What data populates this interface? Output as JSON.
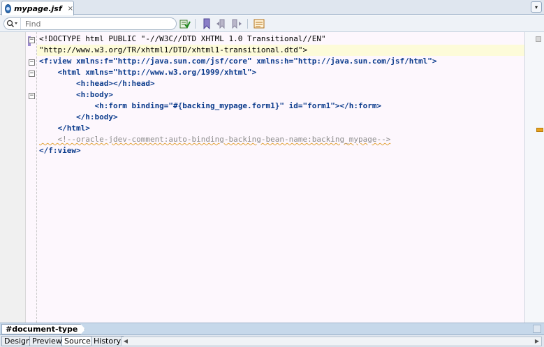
{
  "tab": {
    "title": "mypage.jsf",
    "close_glyph": "×",
    "icon": "jsf-file-icon"
  },
  "tab_menu_glyph": "▾",
  "toolbar": {
    "find_placeholder": "Find",
    "icons": [
      "search-icon",
      "validate-icon",
      "bookmark-icon",
      "previous-bookmark-icon",
      "next-bookmark-icon",
      "properties-icon"
    ]
  },
  "code_lines": [
    "<!DOCTYPE html PUBLIC \"-//W3C//DTD XHTML 1.0 Transitional//EN\"",
    "\"http://www.w3.org/TR/xhtml1/DTD/xhtml1-transitional.dtd\">",
    "<f:view xmlns:f=\"http://java.sun.com/jsf/core\" xmlns:h=\"http://java.sun.com/jsf/html\">",
    "    <html xmlns=\"http://www.w3.org/1999/xhtml\">",
    "        <h:head></h:head>",
    "        <h:body>",
    "            <h:form binding=\"#{backing_mypage.form1}\" id=\"form1\"></h:form>",
    "        </h:body>",
    "    </html>",
    "    <!--oracle-jdev-comment:auto-binding-backing-bean-name:backing_mypage-->",
    "</f:view>"
  ],
  "breadcrumb": {
    "label": "#document-type"
  },
  "editor_tabs": [
    {
      "label": "Design",
      "active": false
    },
    {
      "label": "Preview",
      "active": false
    },
    {
      "label": "Source",
      "active": true
    },
    {
      "label": "History",
      "active": false
    }
  ],
  "colors": {
    "accent": "#2f6db3",
    "tag": "#0b3b8c",
    "attribute": "#8b1a1a",
    "string": "#1e2ea0",
    "comment": "#8c8c8c",
    "warning_mark": "#e7a21e"
  }
}
